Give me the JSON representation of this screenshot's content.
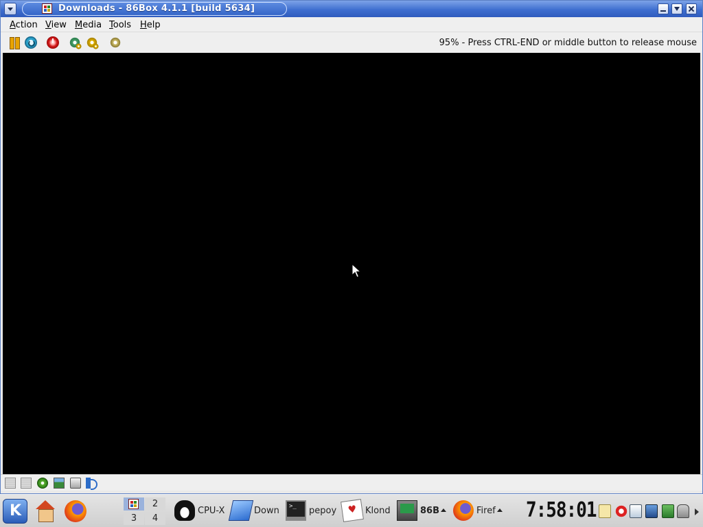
{
  "window": {
    "title": "Downloads - 86Box 4.1.1 [build 5634]",
    "icons": {
      "menu": "window-menu-icon",
      "app": "86box-app-icon",
      "minimize": "minimize-icon",
      "maximize": "maximize-icon",
      "close": "close-icon"
    }
  },
  "menubar": {
    "items": [
      "Action",
      "View",
      "Media",
      "Tools",
      "Help"
    ]
  },
  "toolbar": {
    "icons": [
      "pause-icon",
      "reset-icon",
      "power-icon",
      "ctrl-alt-del-icon",
      "ctrl-alt-esc-icon",
      "settings-icon"
    ],
    "status_message": "95% - Press CTRL-END or middle button to release mouse"
  },
  "screen": {
    "background": "#000000",
    "cursor": "mouse-pointer-icon"
  },
  "statusbar": {
    "icons": [
      "floppy-1-icon",
      "floppy-2-icon",
      "cdrom-icon",
      "network-icon",
      "hard-disk-icon",
      "sound-icon"
    ]
  },
  "taskbar": {
    "launchers": [
      "kde-menu-icon",
      "home-icon",
      "firefox-icon"
    ],
    "pager": [
      "1",
      "2",
      "3",
      "4"
    ],
    "tasks": [
      {
        "label": "CPU-X",
        "icon": "tux-icon"
      },
      {
        "label": "Down",
        "icon": "folder-icon"
      },
      {
        "label": "pepoy",
        "icon": "terminal-icon"
      },
      {
        "label": "Klond",
        "icon": "cards-icon"
      },
      {
        "label": "86B",
        "icon": "86box-icon"
      },
      {
        "label": "Firef",
        "icon": "firefox-icon"
      }
    ],
    "clock": "7:58:01",
    "tray": [
      "klipper-icon",
      "network-error-icon",
      "clipboard-icon",
      "display-icon",
      "update-icon",
      "lock-icon"
    ]
  },
  "colors": {
    "titlebar": "#3f6fd0",
    "window_bg": "#efefef",
    "screen_bg": "#000000",
    "taskbar_bg": "#d8d8d8"
  }
}
